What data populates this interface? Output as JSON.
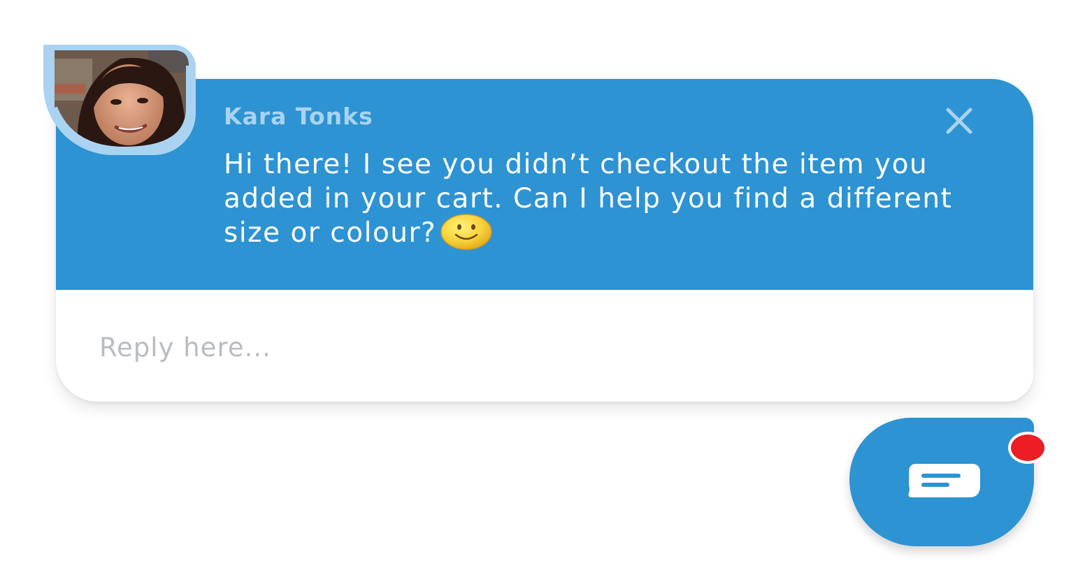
{
  "chat": {
    "agent_name": "Kara Tonks",
    "message": "Hi there! I see you didn’t checkout the item you added in your cart. Can I help you find a different size or colour?",
    "emoji_icon": "smiley-emoji-icon",
    "close_icon": "close-icon",
    "reply_placeholder": "Reply here...",
    "reply_value": ""
  },
  "launcher": {
    "icon": "chat-bubble-icon",
    "has_unread": true
  },
  "colors": {
    "header_blue": "#2d93d3",
    "name_text": "#a9d3f0",
    "message_text": "#ffffff",
    "placeholder_text": "#b9bcc0",
    "notification_red": "#ec1d24"
  }
}
